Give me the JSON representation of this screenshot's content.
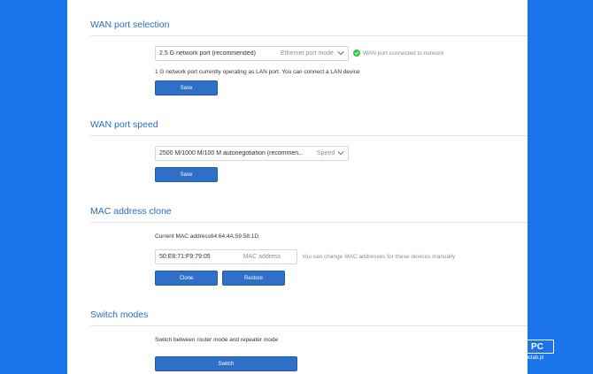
{
  "wan_port_selection": {
    "title": "WAN port selection",
    "select_value": "2.5 G network port (recommended)",
    "select_hint": "Ethernet port mode",
    "status_text": "WAN port connected to network",
    "info_text": "1 G network port currently operating as LAN port. You can connect a LAN device",
    "save_label": "Save"
  },
  "wan_port_speed": {
    "title": "WAN port speed",
    "select_value": "2500 M/1000 M/100 M autonegotiation (recommen...",
    "select_hint": "Speed",
    "save_label": "Save"
  },
  "mac_clone": {
    "title": "MAC address clone",
    "current_mac_text": "Current MAC address64:64:4A:59:58:1D",
    "input_value": "50:E8:71:F9:79:05",
    "input_hint": "MAC address",
    "help_text": "You can change MAC addresses for these devices manually",
    "clone_label": "Clone",
    "restore_label": "Restore"
  },
  "switch_modes": {
    "title": "Switch modes",
    "info_text": "Switch between router mode and repeater mode",
    "switch_label": "Switch"
  },
  "watermark": {
    "logo_text": "PC",
    "sub_text": "pclab.pl"
  },
  "colors": {
    "background": "#1a73e8",
    "accent": "#2f6fc8",
    "title": "#2a6ebd",
    "status_ok": "#2ecc40"
  }
}
